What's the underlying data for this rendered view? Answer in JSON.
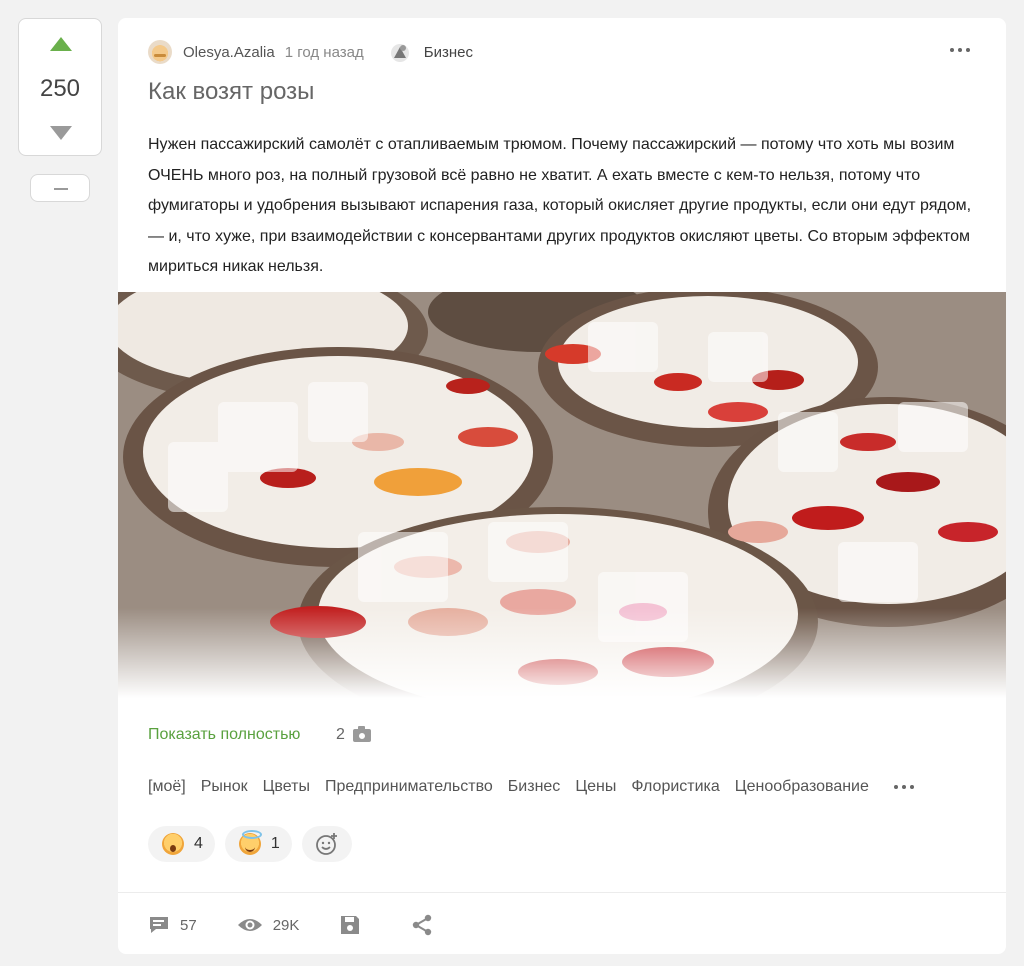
{
  "vote": {
    "count": "250"
  },
  "post": {
    "author": "Olesya.Azalia",
    "time": "1 год назад",
    "community": "Бизнес",
    "title": "Как возят розы",
    "body": "Нужен пассажирский самолёт с отапливаемым трюмом. Почему пассажирский — потому что хоть мы возим ОЧЕНЬ много роз, на полный грузовой всё равно не хватит. А ехать вместе с кем-то нельзя, потому что фумигаторы и удобрения вызывают испарения газа, который окисляет другие продукты, если они едут рядом, — и, что хуже, при взаимодействии с консервантами других продуктов окисляют цветы. Со вторым эффектом мириться никак нельзя.",
    "show_full": "Показать полностью",
    "photo_count": "2"
  },
  "tags": [
    "[моё]",
    "Рынок",
    "Цветы",
    "Предпринимательство",
    "Бизнес",
    "Цены",
    "Флористика",
    "Ценообразование"
  ],
  "reactions": [
    {
      "icon": "shocked-face-icon",
      "count": "4"
    },
    {
      "icon": "halo-face-icon",
      "count": "1"
    }
  ],
  "footer": {
    "comments": "57",
    "views": "29K"
  },
  "colors": {
    "accent": "#5aa13f",
    "vote_up": "#6ab04c",
    "background": "#f2f2f2"
  }
}
